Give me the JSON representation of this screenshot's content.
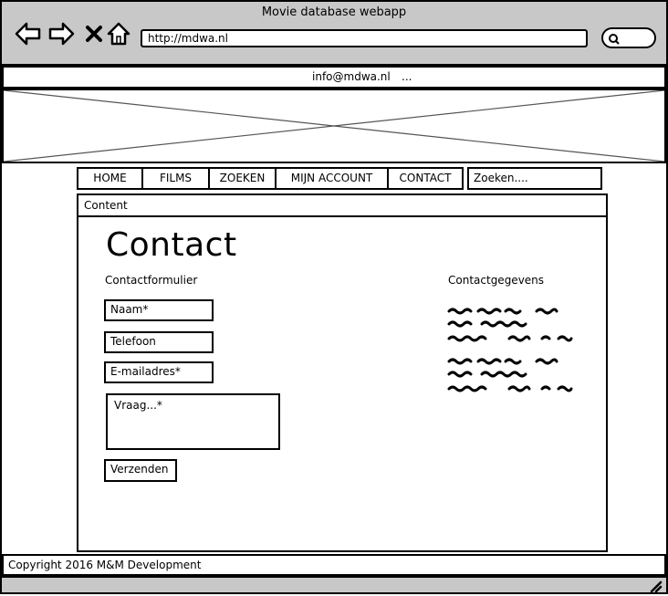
{
  "window": {
    "title": "Movie database webapp",
    "url": "http://mdwa.nl"
  },
  "topbar": {
    "email": "info@mdwa.nl",
    "dots": "..."
  },
  "nav": {
    "items": [
      "HOME",
      "FILMS",
      "ZOEKEN",
      "MIJN ACCOUNT",
      "CONTACT"
    ],
    "search_placeholder": "Zoeken...."
  },
  "content": {
    "header": "Content",
    "title": "Contact",
    "form": {
      "label": "Contactformulier",
      "name": "Naam*",
      "phone": "Telefoon",
      "email": "E-mailadres*",
      "question": "Vraag...*",
      "submit": "Verzenden"
    },
    "details": {
      "label": "Contactgegevens"
    }
  },
  "footer": {
    "copyright": "Copyright 2016 M&M Development"
  }
}
